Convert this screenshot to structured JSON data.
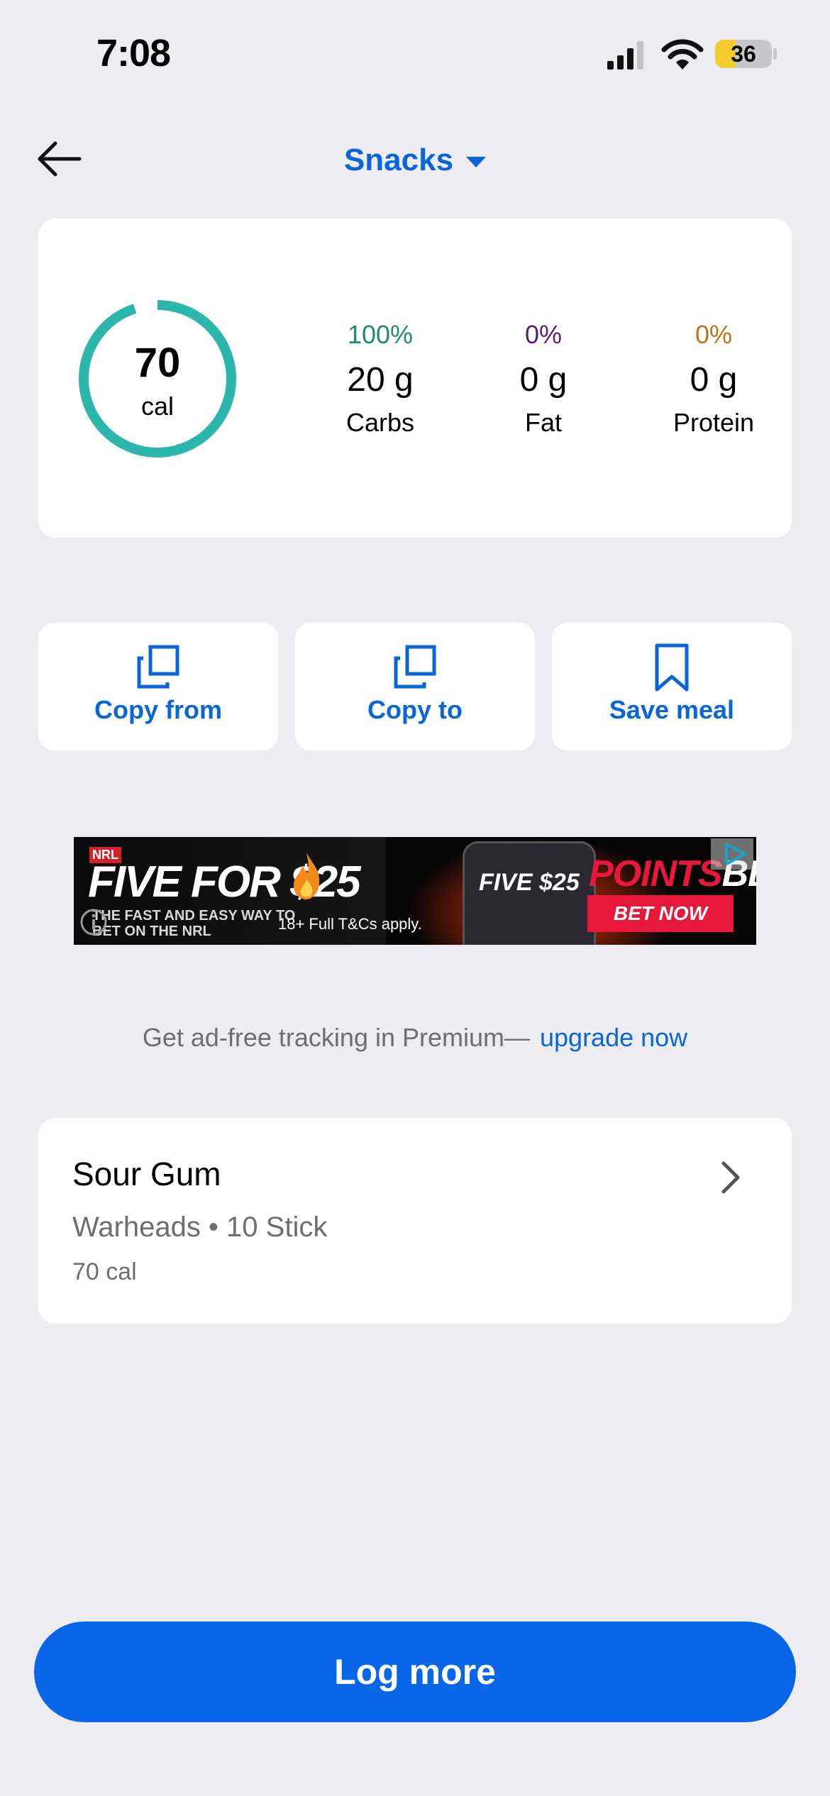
{
  "status_bar": {
    "time": "7:08",
    "battery": "36"
  },
  "header": {
    "title": "Snacks",
    "back_icon": "arrow-left-icon",
    "dropdown_icon": "caret-down-icon"
  },
  "summary": {
    "calories": "70",
    "calories_unit": "cal",
    "ring_progress": 0.95,
    "ring_color": "#2cb7ac",
    "macros": [
      {
        "percent": "100%",
        "grams": "20 g",
        "name": "Carbs",
        "color": "#1f8a72"
      },
      {
        "percent": "0%",
        "grams": "0 g",
        "name": "Fat",
        "color": "#5b1e6e"
      },
      {
        "percent": "0%",
        "grams": "0 g",
        "name": "Protein",
        "color": "#b8761a"
      }
    ]
  },
  "actions": [
    {
      "label": "Copy from",
      "icon": "copy-icon"
    },
    {
      "label": "Copy to",
      "icon": "copy-icon"
    },
    {
      "label": "Save meal",
      "icon": "bookmark-icon"
    }
  ],
  "ad": {
    "league": "NRL",
    "headline": "FIVE FOR $25",
    "tagline": "THE FAST AND EASY WAY TO BET ON THE NRL",
    "terms": "18+ Full T&Cs apply.",
    "phone_text": "FIVE $25",
    "brand_red": "POINTS",
    "brand_white": "BET",
    "cta": "BET NOW"
  },
  "premium": {
    "text": "Get ad-free tracking in Premium—",
    "link": "upgrade now"
  },
  "food_entry": {
    "name": "Sour Gum",
    "detail": "Warheads • 10 Stick",
    "calories": "70 cal"
  },
  "log_more": {
    "label": "Log more"
  },
  "colors": {
    "accent": "#0a66d8",
    "background": "#ececf1",
    "primary_button": "#0a66e8"
  }
}
